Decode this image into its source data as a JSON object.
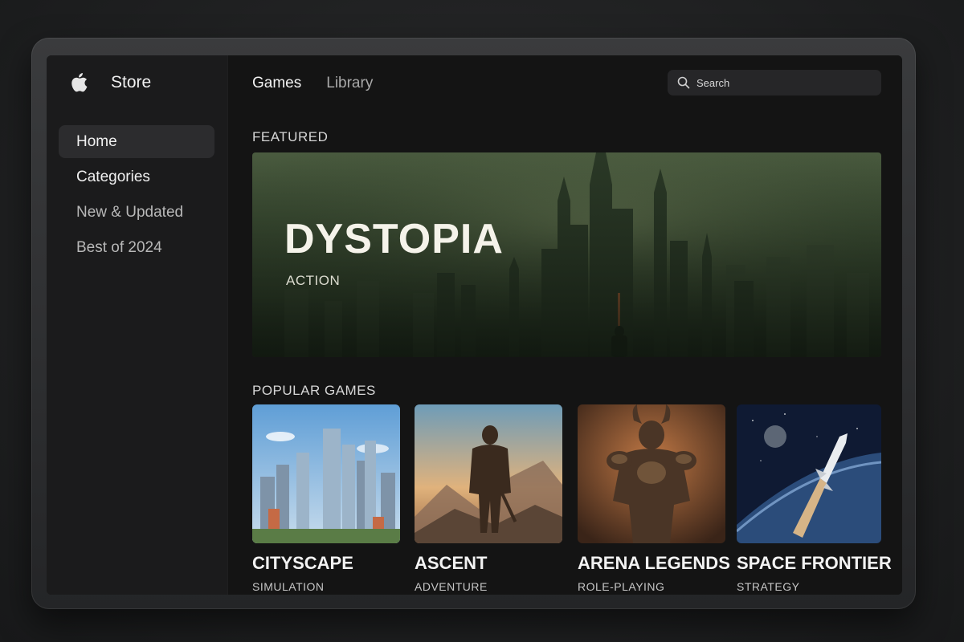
{
  "app": {
    "title": "Store"
  },
  "sidebar": {
    "items": [
      {
        "label": "Home",
        "active": true
      },
      {
        "label": "Categories"
      },
      {
        "label": "New & Updated"
      },
      {
        "label": "Best of 2024"
      }
    ]
  },
  "header": {
    "tabs": [
      {
        "label": "Games",
        "active": true
      },
      {
        "label": "Library"
      }
    ],
    "search": {
      "placeholder": "Search",
      "icon": "search-icon"
    }
  },
  "featured": {
    "section_label": "FEATURED",
    "title": "DYSTOPIA",
    "genre": "ACTION"
  },
  "popular": {
    "section_label": "POPULAR GAMES",
    "games": [
      {
        "title": "CITYSCAPE",
        "genre": "SIMULATION"
      },
      {
        "title": "ASCENT",
        "genre": "ADVENTURE"
      },
      {
        "title": "ARENA LEGENDS",
        "genre": "ROLE-PLAYING"
      },
      {
        "title": "SPACE FRONTIER",
        "genre": "STRATEGY"
      }
    ]
  },
  "colors": {
    "accent_hero": "#3e5035",
    "background": "#141414",
    "sidebar": "#1b1b1c"
  }
}
